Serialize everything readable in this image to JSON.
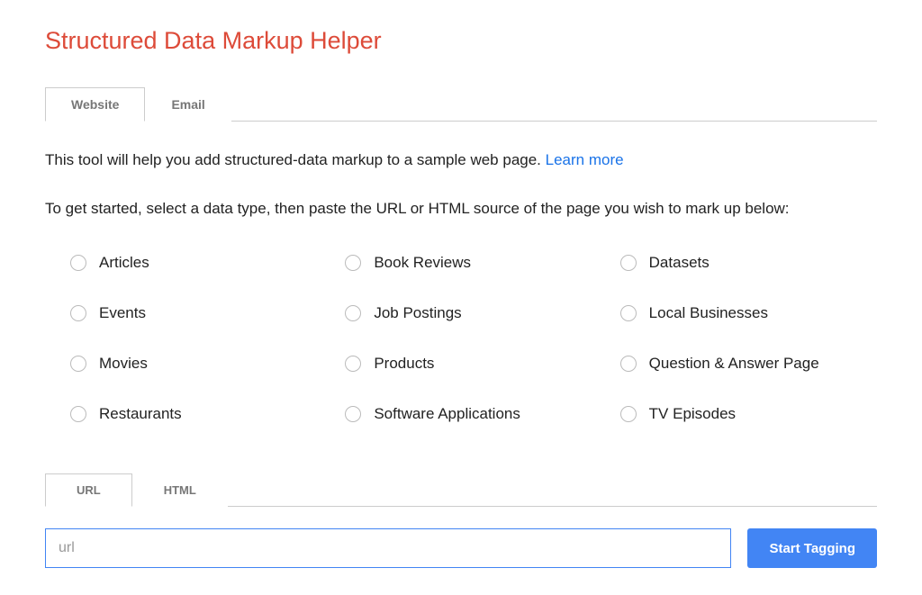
{
  "header": {
    "title": "Structured Data Markup Helper"
  },
  "topTabs": {
    "website": "Website",
    "email": "Email"
  },
  "intro": {
    "text": "This tool will help you add structured-data markup to a sample web page. ",
    "linkText": "Learn more"
  },
  "instructions": "To get started, select a data type, then paste the URL or HTML source of the page you wish to mark up below:",
  "dataTypes": {
    "articles": "Articles",
    "bookReviews": "Book Reviews",
    "datasets": "Datasets",
    "events": "Events",
    "jobPostings": "Job Postings",
    "localBusinesses": "Local Businesses",
    "movies": "Movies",
    "products": "Products",
    "qaPage": "Question & Answer Page",
    "restaurants": "Restaurants",
    "softwareApps": "Software Applications",
    "tvEpisodes": "TV Episodes"
  },
  "bottomTabs": {
    "url": "URL",
    "html": "HTML"
  },
  "form": {
    "urlPlaceholder": "url",
    "startButton": "Start Tagging"
  }
}
